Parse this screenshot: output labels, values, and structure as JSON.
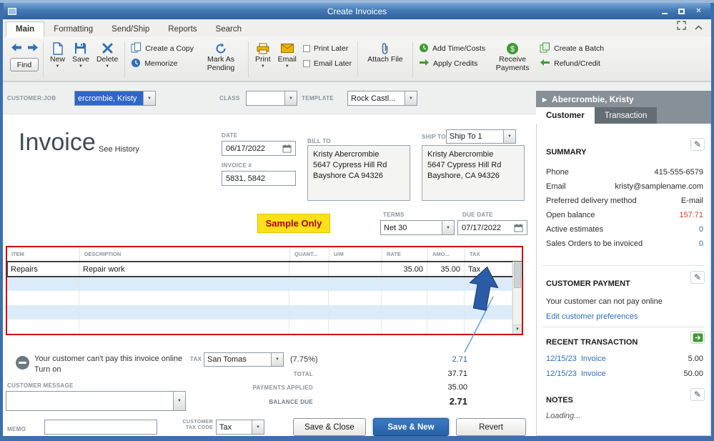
{
  "window": {
    "title": "Create Invoices"
  },
  "menu_tabs": [
    "Main",
    "Formatting",
    "Send/Ship",
    "Reports",
    "Search"
  ],
  "toolbar": {
    "find": "Find",
    "new": "New",
    "save": "Save",
    "delete": "Delete",
    "create_copy": "Create a Copy",
    "memorize": "Memorize",
    "mark_pending": "Mark As Pending",
    "print": "Print",
    "email": "Email",
    "print_later": "Print Later",
    "email_later": "Email Later",
    "attach_file": "Attach File",
    "add_time_costs": "Add Time/Costs",
    "apply_credits": "Apply Credits",
    "receive_payments": "Receive Payments",
    "create_batch": "Create a Batch",
    "refund_credit": "Refund/Credit"
  },
  "form": {
    "customer_job_label": "CUSTOMER:JOB",
    "customer_job_value": "ercrombie, Kristy",
    "class_label": "CLASS",
    "class_value": "",
    "template_label": "TEMPLATE",
    "template_value": "Rock Castl...",
    "invoice_title": "Invoice",
    "see_history": "See History",
    "date_label": "DATE",
    "date_value": "06/17/2022",
    "invoice_number_label": "INVOICE #",
    "invoice_number_value": "5831, 5842",
    "bill_to_label": "BILL TO",
    "bill_to": [
      "Kristy Abercrombie",
      "5647 Cypress Hill Rd",
      "Bayshore CA 94326"
    ],
    "ship_to_label": "SHIP TO",
    "ship_to_value": "Ship To 1",
    "ship_to": [
      "Kristy Abercrombie",
      "5647 Cypress Hill Rd",
      "Bayshore, CA 94326"
    ],
    "sample_only": "Sample Only",
    "terms_label": "TERMS",
    "terms_value": "Net 30",
    "due_date_label": "DUE DATE",
    "due_date_value": "07/17/2022"
  },
  "table": {
    "columns": [
      "ITEM",
      "DESCRIPTION",
      "QUANT...",
      "U/M",
      "RATE",
      "AMO...",
      "TAX"
    ],
    "rows": [
      {
        "item": "Repairs",
        "description": "Repair work",
        "quantity": "",
        "um": "",
        "rate": "35.00",
        "amount": "35.00",
        "tax": "Tax"
      }
    ]
  },
  "totals": {
    "tax_label": "TAX",
    "tax_value": "San Tomas",
    "tax_rate": "(7.75%)",
    "tax_amount": "2.71",
    "total_label": "TOTAL",
    "total_value": "37.71",
    "payments_label": "PAYMENTS APPLIED",
    "payments_value": "35.00",
    "balance_label": "BALANCE DUE",
    "balance_value": "2.71"
  },
  "footer": {
    "online_message": "Your customer can't pay this invoice online",
    "turn_on": "Turn on",
    "customer_message_label": "CUSTOMER MESSAGE",
    "customer_message_value": "",
    "memo_label": "MEMO",
    "memo_value": "",
    "customer_tax_code_label": "CUSTOMER TAX CODE",
    "customer_tax_code_value": "Tax",
    "save_close": "Save & Close",
    "save_new": "Save & New",
    "revert": "Revert"
  },
  "panel": {
    "customer_name": "Abercrombie, Kristy",
    "tabs": [
      "Customer",
      "Transaction"
    ],
    "summary": {
      "title": "SUMMARY",
      "rows": [
        {
          "label": "Phone",
          "value": "415-555-6579"
        },
        {
          "label": "Email",
          "value": "kristy@samplename.com"
        },
        {
          "label": "Preferred delivery method",
          "value": "E-mail"
        },
        {
          "label": "Open balance",
          "value": "157.71"
        },
        {
          "label": "Active estimates",
          "value": "0"
        },
        {
          "label": "Sales Orders to be invoiced",
          "value": "0"
        }
      ]
    },
    "payment": {
      "title": "CUSTOMER PAYMENT",
      "message": "Your customer can not pay online",
      "link": "Edit customer preferences"
    },
    "recent": {
      "title": "RECENT TRANSACTION",
      "rows": [
        {
          "date": "12/15/23",
          "type": "Invoice",
          "amount": "5.00"
        },
        {
          "date": "12/15/23",
          "type": "Invoice",
          "amount": "50.00"
        }
      ]
    },
    "notes": {
      "title": "NOTES",
      "content": "Loading..."
    }
  },
  "colors": {
    "titlebar_blue": "#3d76b4",
    "selection_blue": "#2e66c9",
    "primary_button_blue": "#2966b1",
    "table_border_red": "#d40000",
    "highlight_yellow": "#ffe11a",
    "balance_red": "#e03c31",
    "link_blue": "#2d6fc0",
    "annotation_arrow_blue": "#2b5ca8"
  }
}
